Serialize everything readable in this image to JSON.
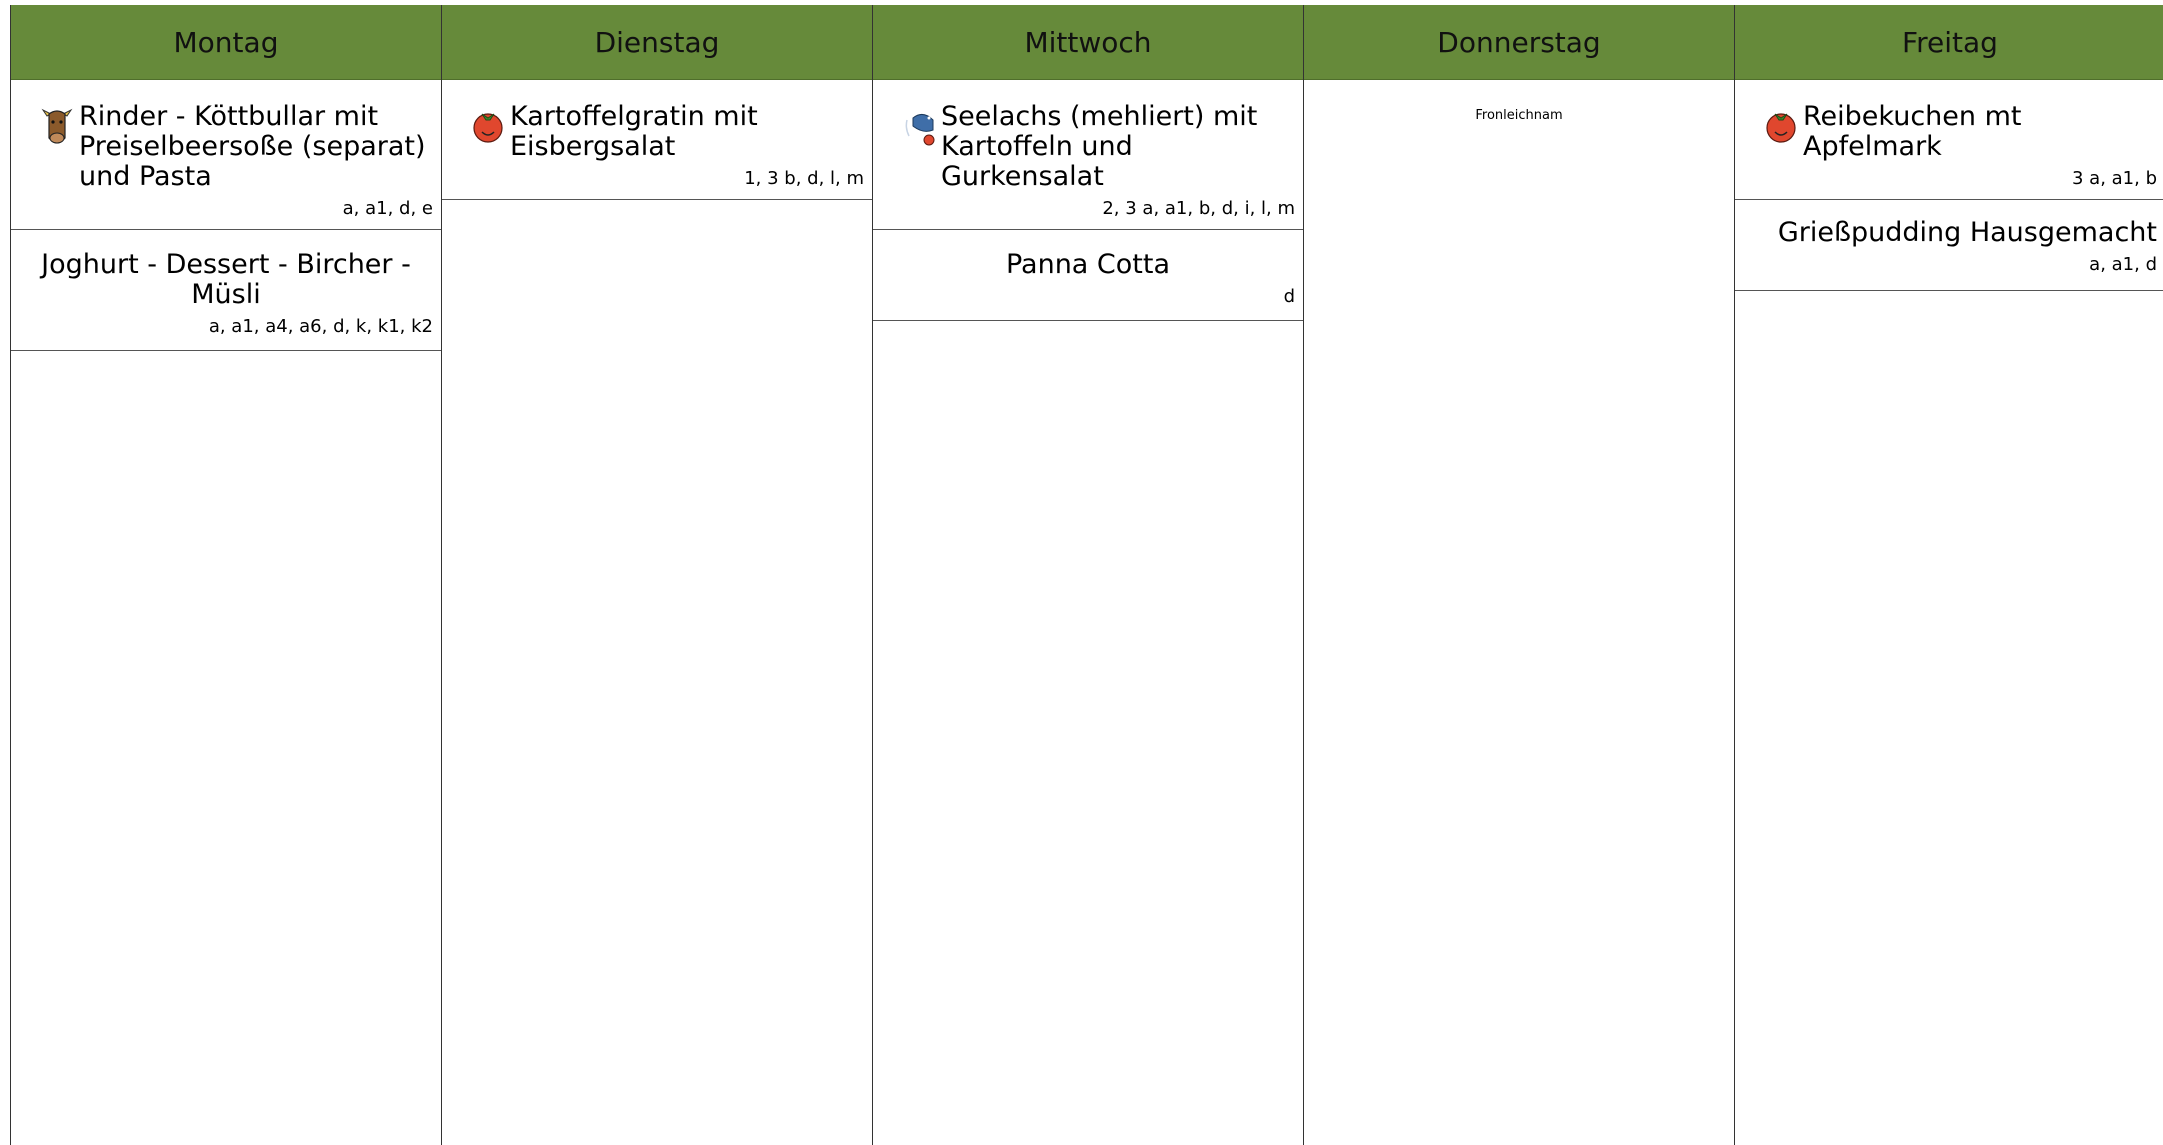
{
  "days": [
    {
      "label": "Montag",
      "meals": [
        {
          "icon": "cow-icon",
          "name": "Rinder - Köttbullar mit Preiselbeersoße (separat) und Pasta",
          "allergens": "a, a1, d, e"
        },
        {
          "icon": "",
          "name": "Joghurt - Dessert - Bircher - Müsli",
          "allergens": "a, a1, a4, a6, d, k, k1, k2"
        }
      ]
    },
    {
      "label": "Dienstag",
      "meals": [
        {
          "icon": "tomato-icon",
          "name": "Kartoffelgratin mit Eisbergsalat",
          "allergens": "1, 3 b, d, l, m"
        }
      ]
    },
    {
      "label": "Mittwoch",
      "meals": [
        {
          "icon": "fish-icon",
          "name": "Seelachs (mehliert) mit Kartoffeln und Gurkensalat",
          "allergens": "2, 3 a, a1, b, d, i, l, m"
        },
        {
          "icon": "",
          "name": "Panna Cotta",
          "allergens": "d"
        }
      ]
    },
    {
      "label": "Donnerstag",
      "holiday": "Fronleichnam",
      "meals": []
    },
    {
      "label": "Freitag",
      "meals": [
        {
          "icon": "tomato-icon",
          "name": "Reibekuchen mt Apfelmark",
          "allergens": "3 a, a1, b"
        },
        {
          "icon": "",
          "name": "Grießpudding Hausgemacht",
          "allergens": "a, a1, d"
        }
      ]
    }
  ],
  "colors": {
    "header": "#668a3a"
  }
}
